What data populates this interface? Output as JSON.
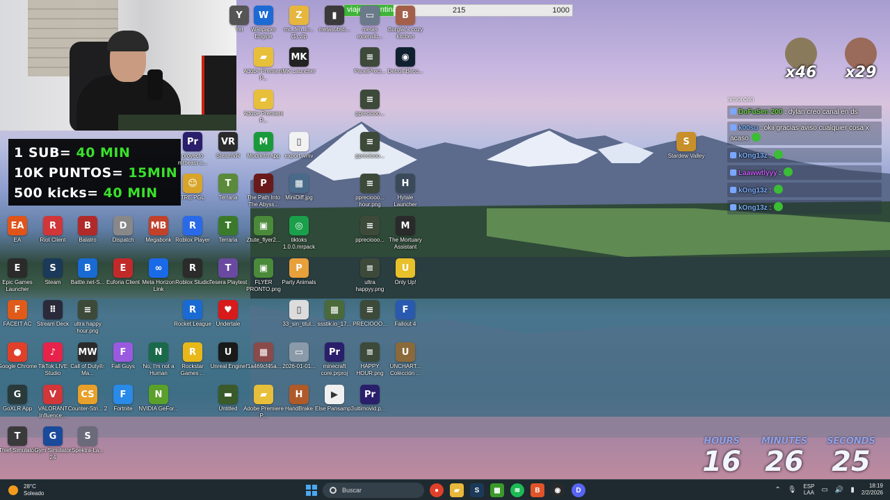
{
  "webcam": {
    "name": "streamer-webcam"
  },
  "goals": {
    "lines": [
      {
        "prefix": "1 SUB= ",
        "value": "40 MIN"
      },
      {
        "prefix": "10K PUNTOS= ",
        "value": "15MIN"
      },
      {
        "prefix": "500 kicks= ",
        "value": "40 MIN"
      }
    ]
  },
  "goal_bar": {
    "label": "viaje argentina",
    "current": "215",
    "max": "1000",
    "fraction": 0.215
  },
  "reactions": [
    {
      "count": "x46",
      "color": "#8a7a5c"
    },
    {
      "count": "x29",
      "color": "#9a6a5a"
    }
  ],
  "chat": {
    "top": "amorcito",
    "messages": [
      {
        "user": "DoFuSen 200",
        "text": ": dylan creo canal en ds",
        "color": "#6bd04a"
      },
      {
        "user": "k00su",
        "text": ": okii gracias aviso cualquier cosa x acaso",
        "color": "#7ab0ff"
      },
      {
        "user": "kOng13z",
        "text": ":",
        "color": "#7ab0ff"
      },
      {
        "user": "Laawwtlyyy",
        "text": ":",
        "color": "#c45cf0"
      },
      {
        "user": "kOng13z",
        "text": ":",
        "color": "#7ab0ff"
      },
      {
        "user": "kOng13z",
        "text": ":",
        "color": "#7ab0ff"
      }
    ]
  },
  "countdown": {
    "hours_label": "HOURS",
    "hours": "16",
    "minutes_label": "MINUTES",
    "minutes": "26",
    "seconds_label": "SECONDS",
    "seconds": "25"
  },
  "icons": [
    {
      "label": "Wallpaper Engine",
      "glyph": "W",
      "color": "#1c6ad4"
    },
    {
      "label": "mc_fen_lo... (1).zip",
      "glyph": "Z",
      "color": "#e6b63d"
    },
    {
      "label": "metasubsti...",
      "glyph": "▮",
      "color": "#3a3a3a"
    },
    {
      "label": "metas extensib...",
      "glyph": "▭",
      "color": "#6b7a8a"
    },
    {
      "label": "Burglar's cozy kitchen",
      "glyph": "B",
      "color": "#a2604a"
    },
    {
      "label": "Adobe Premiere P...",
      "glyph": "▰",
      "color": "#e8bf3a"
    },
    {
      "label": "MK Launcher",
      "glyph": "MK",
      "color": "#222"
    },
    {
      "label": "PanelPreci...",
      "glyph": "≡",
      "color": "#3d4a3a"
    },
    {
      "label": "Detroit Beco...",
      "glyph": "◉",
      "color": "#102030"
    },
    {
      "label": "Adobe Premiere P...",
      "glyph": "▰",
      "color": "#e8bf3a"
    },
    {
      "label": "ppreciooo...",
      "glyph": "≡",
      "color": "#3d4a3a"
    },
    {
      "label": "proyecto mrbeast a...",
      "glyph": "Pr",
      "color": "#2a1f6b"
    },
    {
      "label": "SteamVR",
      "glyph": "VR",
      "color": "#2b2b2b"
    },
    {
      "label": "Modrinth App",
      "glyph": "M",
      "color": "#1a9a3a"
    },
    {
      "label": "export.wmv",
      "glyph": "▯",
      "color": "#f2f2f2"
    },
    {
      "label": "ppreciooo...",
      "glyph": "≡",
      "color": "#3d4a3a"
    },
    {
      "label": "TRE PGL",
      "glyph": "☺",
      "color": "#d8a52a"
    },
    {
      "label": "Terraria",
      "glyph": "T",
      "color": "#5a8a3a"
    },
    {
      "label": "The Path Into The Abyss...",
      "glyph": "P",
      "color": "#6a1a1a"
    },
    {
      "label": "MiniDiff.jpg",
      "glyph": "▦",
      "color": "#4a6a8a"
    },
    {
      "label": "ppreciooo... hour.png",
      "glyph": "≡",
      "color": "#3d4a3a"
    },
    {
      "label": "Hytale Launcher",
      "glyph": "H",
      "color": "#3a4a5a"
    },
    {
      "label": "EA",
      "glyph": "EA",
      "color": "#e0541a"
    },
    {
      "label": "Riot Client",
      "glyph": "R",
      "color": "#d13639"
    },
    {
      "label": "Balatro",
      "glyph": "B",
      "color": "#b02a2a"
    },
    {
      "label": "Dispatch",
      "glyph": "D",
      "color": "#888"
    },
    {
      "label": "Megabonk",
      "glyph": "MB",
      "color": "#c2412a"
    },
    {
      "label": "Roblox Player",
      "glyph": "R",
      "color": "#2a6ae8"
    },
    {
      "label": "Terraria",
      "glyph": "T",
      "color": "#3a7a2a"
    },
    {
      "label": "Ztute_flyer2...",
      "glyph": "▣",
      "color": "#4a8a3a"
    },
    {
      "label": "tiktoks 1.0.0.mrpack",
      "glyph": "◎",
      "color": "#1aa04a"
    },
    {
      "label": "ppreciooo...",
      "glyph": "≡",
      "color": "#3d4a3a"
    },
    {
      "label": "The Mortuary Assistant",
      "glyph": "M",
      "color": "#2a2a2a"
    },
    {
      "label": "Epic Games Launcher",
      "glyph": "E",
      "color": "#2b2b2b"
    },
    {
      "label": "Steam",
      "glyph": "S",
      "color": "#1b3a5a"
    },
    {
      "label": "Battle.net-S...",
      "glyph": "B",
      "color": "#1a6ad4"
    },
    {
      "label": "Euforia Client",
      "glyph": "E",
      "color": "#c22a2a"
    },
    {
      "label": "Meta Horizon Link",
      "glyph": "∞",
      "color": "#1a6ae8"
    },
    {
      "label": "Roblox Studio",
      "glyph": "R",
      "color": "#2b2b2b"
    },
    {
      "label": "Tesera Playtest",
      "glyph": "T",
      "color": "#6a4aa0"
    },
    {
      "label": "FLYER PRONTO.png",
      "glyph": "▣",
      "color": "#4a8a3a"
    },
    {
      "label": "Party Animals",
      "glyph": "P",
      "color": "#e8a03a"
    },
    {
      "label": "ultra happyy.png",
      "glyph": "≡",
      "color": "#3d4a3a"
    },
    {
      "label": "Only Up!",
      "glyph": "U",
      "color": "#e8c02a"
    },
    {
      "label": "FACEIT AC",
      "glyph": "F",
      "color": "#e05a1a"
    },
    {
      "label": "Stream Deck",
      "glyph": "⠿",
      "color": "#2a2a3a"
    },
    {
      "label": "ultra happy hour.png",
      "glyph": "≡",
      "color": "#3d4a3a"
    },
    {
      "label": "Rocket League",
      "glyph": "R",
      "color": "#1a6ad4"
    },
    {
      "label": "Undertale",
      "glyph": "♥",
      "color": "#d81a1a"
    },
    {
      "label": "33_sin_titul...",
      "glyph": "▯",
      "color": "#dcdcdc"
    },
    {
      "label": "ssstik.io_17...",
      "glyph": "▦",
      "color": "#4a6a3a"
    },
    {
      "label": "PRECIOOO...",
      "glyph": "≡",
      "color": "#3d4a3a"
    },
    {
      "label": "Fallout 4",
      "glyph": "F",
      "color": "#2a5ab0"
    },
    {
      "label": "Google Chrome",
      "glyph": "●",
      "color": "#e0402a"
    },
    {
      "label": "TikTok LIVE Studio",
      "glyph": "♪",
      "color": "#e8234a"
    },
    {
      "label": "Call of Duty®: Ma...",
      "glyph": "MW",
      "color": "#2a2a2a"
    },
    {
      "label": "Fall Guys",
      "glyph": "F",
      "color": "#9a5ae0"
    },
    {
      "label": "No, I'm not a Human",
      "glyph": "N",
      "color": "#1a6a4a"
    },
    {
      "label": "Rockstar Games ...",
      "glyph": "R",
      "color": "#e8b81a"
    },
    {
      "label": "Unreal Engine",
      "glyph": "U",
      "color": "#1a1a1a"
    },
    {
      "label": "f1a469cf45a...",
      "glyph": "▦",
      "color": "#8a4a4a"
    },
    {
      "label": "2026-01-01...",
      "glyph": "▭",
      "color": "#8a9aa8"
    },
    {
      "label": "minecraft core.prproj",
      "glyph": "Pr",
      "color": "#2a1f6b"
    },
    {
      "label": "HAPPY HOUR.png",
      "glyph": "≡",
      "color": "#3d4a3a"
    },
    {
      "label": "UNCHART... Colección ...",
      "glyph": "U",
      "color": "#8a6a3a"
    },
    {
      "label": "GoXLR App",
      "glyph": "G",
      "color": "#2a3a3a"
    },
    {
      "label": "VALORANT Influence...",
      "glyph": "V",
      "color": "#d13639"
    },
    {
      "label": "Counter-Stri... 2",
      "glyph": "CS",
      "color": "#e8a02a"
    },
    {
      "label": "Fortnite",
      "glyph": "F",
      "color": "#2a8ae8"
    },
    {
      "label": "NVIDIA GeFor...",
      "glyph": "N",
      "color": "#5aa02a"
    },
    {
      "label": "Untitled",
      "glyph": "▬",
      "color": "#3a5a2a"
    },
    {
      "label": "Adobe Premiere P...",
      "glyph": "▰",
      "color": "#e8bf3a"
    },
    {
      "label": "HandBrake",
      "glyph": "H",
      "color": "#b05a2a"
    },
    {
      "label": "Else Pansamp3",
      "glyph": "▶",
      "color": "#f0f0f0"
    },
    {
      "label": "ultimovid.p...",
      "glyph": "Pr",
      "color": "#2a1f6b"
    },
    {
      "label": "Thief Simulator",
      "glyph": "T",
      "color": "#3a3a3a"
    },
    {
      "label": "Gym Simulator 24",
      "glyph": "G",
      "color": "#1a4a9a"
    },
    {
      "label": "Spektra-La...",
      "glyph": "S",
      "color": "#6a6a7a"
    },
    {
      "label": "Stardew Valley",
      "glyph": "S",
      "color": "#c8902a"
    },
    {
      "label": "Yet",
      "glyph": "Y",
      "color": "#555"
    }
  ],
  "taskbar": {
    "weather_temp": "28°C",
    "weather_desc": "Soleado",
    "search_placeholder": "Buscar",
    "lang_top": "ESP",
    "lang_bottom": "LAA",
    "time": "18:19",
    "date": "2/2/2026",
    "notification_count": "9"
  }
}
